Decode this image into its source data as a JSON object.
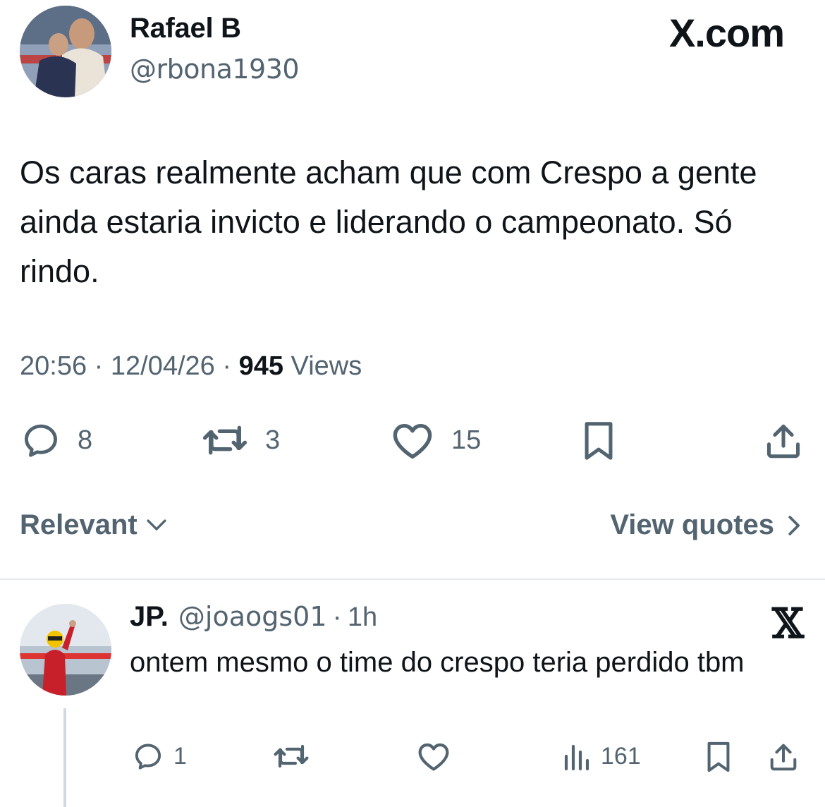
{
  "tweet": {
    "author_name": "Rafael B",
    "author_handle": "@rbona1930",
    "brand": "X.com",
    "text": "Os caras realmente acham que com Crespo a gente ainda estaria invicto e liderando o campeonato. Só rindo.",
    "time": "20:56",
    "date": "12/04/26",
    "views_count": "945",
    "views_label": "Views",
    "replies": "8",
    "retweets": "3",
    "likes": "15"
  },
  "filter": {
    "sort_label": "Relevant",
    "quotes_label": "View quotes"
  },
  "reply": {
    "name": "JP.",
    "handle": "@joaogs01",
    "time": "1h",
    "text": "ontem mesmo o time do crespo teria perdido tbm",
    "replies": "1",
    "views": "161"
  },
  "icons": {
    "reply": "reply-bubble-icon",
    "retweet": "retweet-icon",
    "like": "heart-icon",
    "bookmark": "bookmark-icon",
    "share": "share-icon",
    "views": "views-bars-icon",
    "chevron_down": "chevron-down-icon",
    "chevron_right": "chevron-right-icon",
    "x_logo": "x-logo-icon"
  },
  "colors": {
    "text_primary": "#0f1419",
    "text_secondary": "#536471",
    "divider": "#e6e9eb"
  }
}
